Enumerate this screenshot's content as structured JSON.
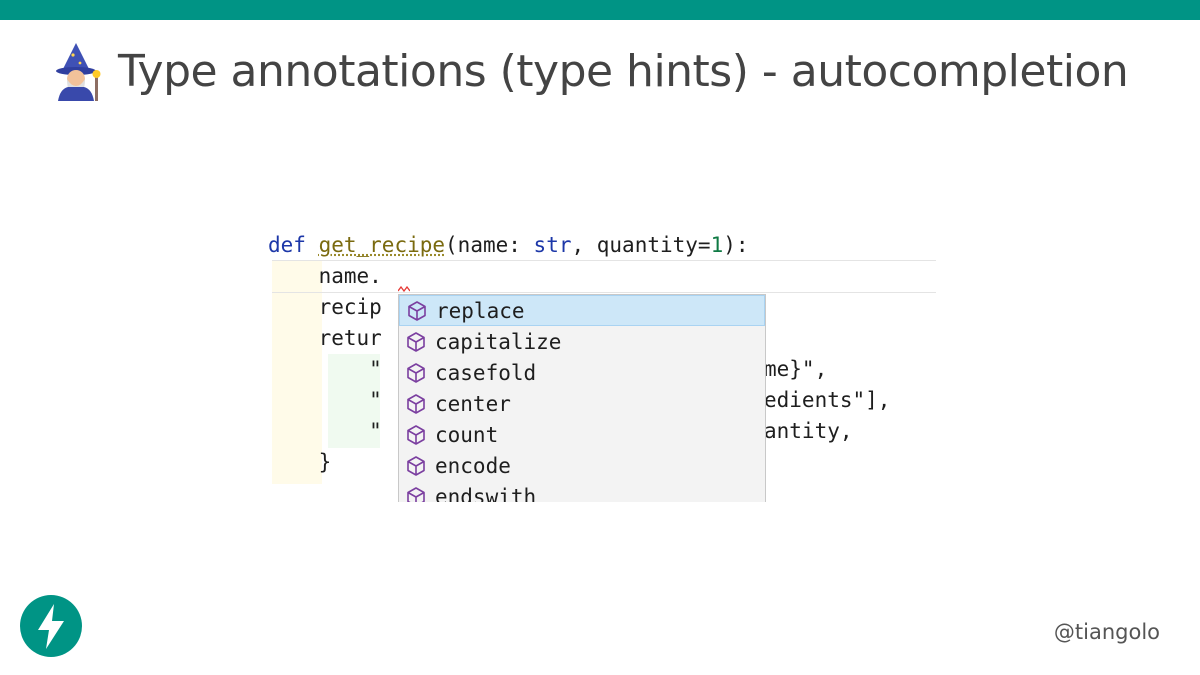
{
  "slide": {
    "title": "Type annotations (type hints) - autocompletion",
    "title_icon": "wizard-emoji-icon",
    "accent_color": "#009485",
    "handle": "@tiangolo",
    "logo_icon": "fastapi-lightning-logo"
  },
  "code": {
    "line1": {
      "def_kw": "def",
      "func_name": "get_recipe",
      "open_paren": "(name: ",
      "type_str": "str",
      "middle": ", quantity=",
      "default_num": "1",
      "close": "):"
    },
    "line2": "    name.",
    "line3": "    recip",
    "line4": "    retur",
    "line5_left": "        \"",
    "line5_right": "me}\",",
    "line6_left": "        \"",
    "line6_right": "edients\"],",
    "line7_left": "        \"",
    "line7_right": "antity,",
    "line8": "    }"
  },
  "completion": {
    "item_icon": "method-cube-icon",
    "items": [
      "replace",
      "capitalize",
      "casefold",
      "center",
      "count",
      "encode",
      "endswith"
    ],
    "selected_index": 0
  }
}
